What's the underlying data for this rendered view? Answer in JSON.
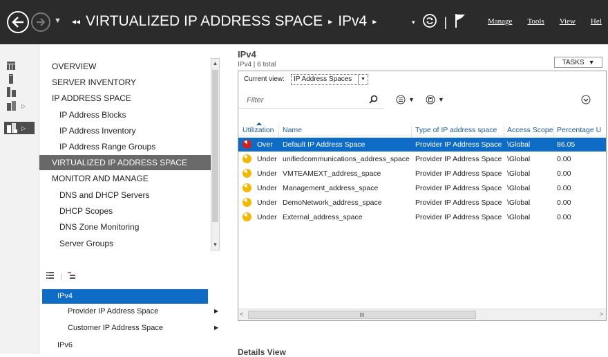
{
  "titlebar": {
    "breadcrumb": [
      "VIRTUALIZED IP ADDRESS SPACE",
      "IPv4"
    ],
    "menu": [
      "Manage",
      "Tools",
      "View",
      "Hel"
    ]
  },
  "nav": {
    "items": [
      {
        "label": "OVERVIEW",
        "type": "top"
      },
      {
        "label": "SERVER INVENTORY",
        "type": "top"
      },
      {
        "label": "IP ADDRESS SPACE",
        "type": "top"
      },
      {
        "label": "IP Address Blocks",
        "type": "sub"
      },
      {
        "label": "IP Address Inventory",
        "type": "sub"
      },
      {
        "label": "IP Address Range Groups",
        "type": "sub"
      },
      {
        "label": "VIRTUALIZED IP ADDRESS SPACE",
        "type": "selected"
      },
      {
        "label": "MONITOR AND MANAGE",
        "type": "top"
      },
      {
        "label": "DNS and DHCP Servers",
        "type": "sub"
      },
      {
        "label": "DHCP Scopes",
        "type": "sub"
      },
      {
        "label": "DNS Zone Monitoring",
        "type": "sub"
      },
      {
        "label": "Server Groups",
        "type": "sub"
      }
    ]
  },
  "tree": {
    "items": [
      {
        "label": "IPv4",
        "selected": true
      },
      {
        "label": "Provider IP Address Space",
        "has_arrow": true
      },
      {
        "label": "Customer IP Address Space",
        "has_arrow": true
      },
      {
        "label": "IPv6"
      }
    ]
  },
  "main": {
    "title": "IPv4",
    "subtitle": "IPv4 | 6 total",
    "tasks_label": "TASKS",
    "current_view_label": "Current view:",
    "current_view_value": "IP Address Spaces",
    "filter_placeholder": "Filter",
    "details_title": "Details View"
  },
  "grid": {
    "columns": [
      "Utilization",
      "Name",
      "Type of IP address space",
      "Access Scope",
      "Percentage U"
    ],
    "rows": [
      {
        "utilization": "Over",
        "name": "Default IP Address Space",
        "type": "Provider IP Address Space",
        "scope": "\\Global",
        "percentage": "86.05",
        "selected": true,
        "status_color": "#d02020"
      },
      {
        "utilization": "Under",
        "name": "unifiedcommunications_address_space",
        "type": "Provider IP Address Space",
        "scope": "\\Global",
        "percentage": "0.00",
        "status_color": "#f5b800"
      },
      {
        "utilization": "Under",
        "name": "VMTEAMEXT_address_space",
        "type": "Provider IP Address Space",
        "scope": "\\Global",
        "percentage": "0.00",
        "status_color": "#f5b800"
      },
      {
        "utilization": "Under",
        "name": "Management_address_space",
        "type": "Provider IP Address Space",
        "scope": "\\Global",
        "percentage": "0.00",
        "status_color": "#f5b800"
      },
      {
        "utilization": "Under",
        "name": "DemoNetwork_address_space",
        "type": "Provider IP Address Space",
        "scope": "\\Global",
        "percentage": "0.00",
        "status_color": "#f5b800"
      },
      {
        "utilization": "Under",
        "name": "External_address_space",
        "type": "Provider IP Address Space",
        "scope": "\\Global",
        "percentage": "0.00",
        "status_color": "#f5b800"
      }
    ]
  },
  "colors": {
    "titlebar_bg": "#2b2b2b",
    "selection_blue": "#0f6cc6",
    "nav_selected_bg": "#696969",
    "header_text": "#1a5a9e"
  },
  "icons": [
    "back-arrow-icon",
    "forward-arrow-icon",
    "refresh-icon",
    "flag-icon",
    "search-icon",
    "dashboard-icon",
    "server-icon",
    "servers-icon",
    "ipam-icon",
    "virtualized-icon",
    "expand-icon"
  ]
}
